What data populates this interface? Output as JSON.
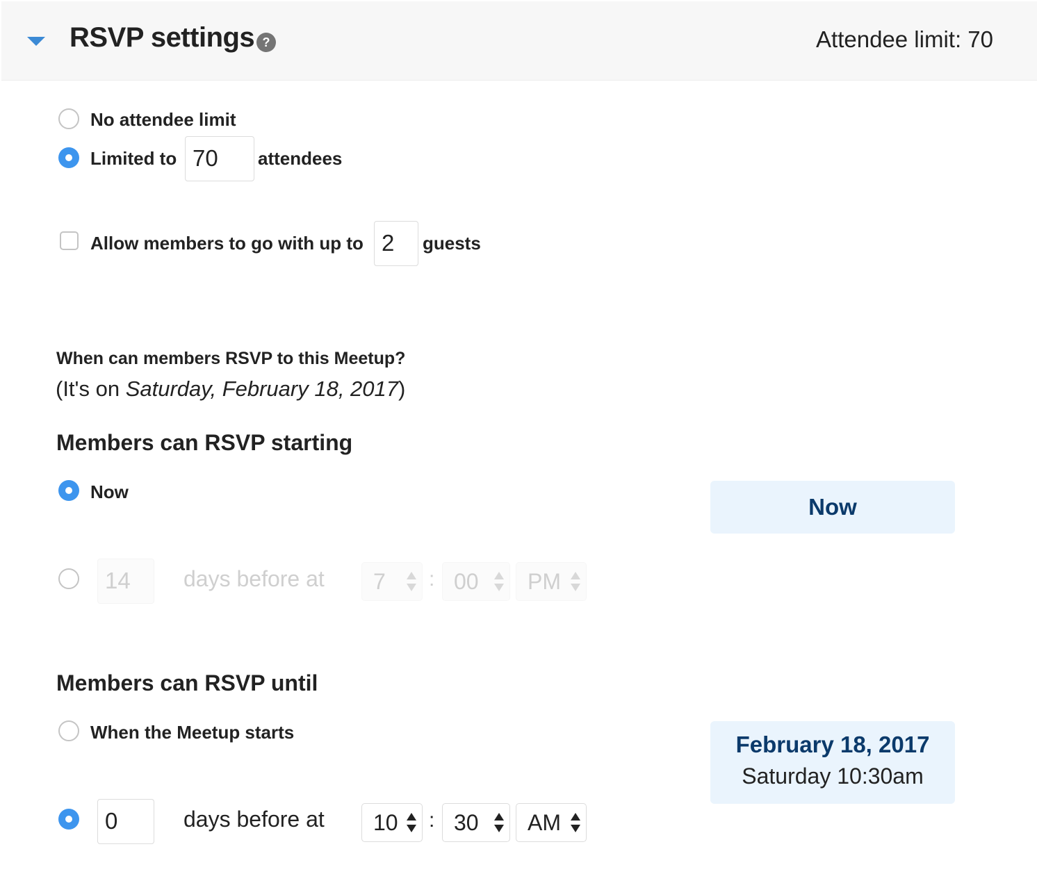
{
  "header": {
    "title": "RSVP settings",
    "help_glyph": "?",
    "attendee_limit_summary": "Attendee limit: 70"
  },
  "attendee_limit": {
    "no_limit_label": "No attendee limit",
    "limited_to_label": "Limited to",
    "limited_to_value": "70",
    "attendees_label": "attendees",
    "selected": "limited"
  },
  "guests": {
    "allow_label": "Allow members to go with up to",
    "guest_count": "2",
    "guests_label": "guests",
    "checked": false
  },
  "rsvp_window": {
    "question": "When can members RSVP to this Meetup?",
    "date_note_prefix": "(It's on ",
    "date_note_date": "Saturday, February 18, 2017",
    "date_note_suffix": ")"
  },
  "rsvp_start": {
    "heading": "Members can RSVP starting",
    "now_label": "Now",
    "days_value": "14",
    "days_before_label": "days before at",
    "hour": "7",
    "colon": ":",
    "minute": "00",
    "ampm": "PM",
    "selected": "now",
    "summary": "Now"
  },
  "rsvp_until": {
    "heading": "Members can RSVP until",
    "meetup_starts_label": "When the Meetup starts",
    "days_value": "0",
    "days_before_label": "days before at",
    "hour": "10",
    "colon": ":",
    "minute": "30",
    "ampm": "AM",
    "selected": "days_before",
    "summary_date": "February 18, 2017",
    "summary_time": "Saturday 10:30am"
  },
  "colors": {
    "accent": "#3d95ee",
    "summary_bg": "#eaf4fd",
    "summary_text": "#0b3a6b",
    "disabled_text": "#cfcfcf"
  },
  "icons": {
    "collapse": "caret-down-icon",
    "help": "help-icon"
  }
}
